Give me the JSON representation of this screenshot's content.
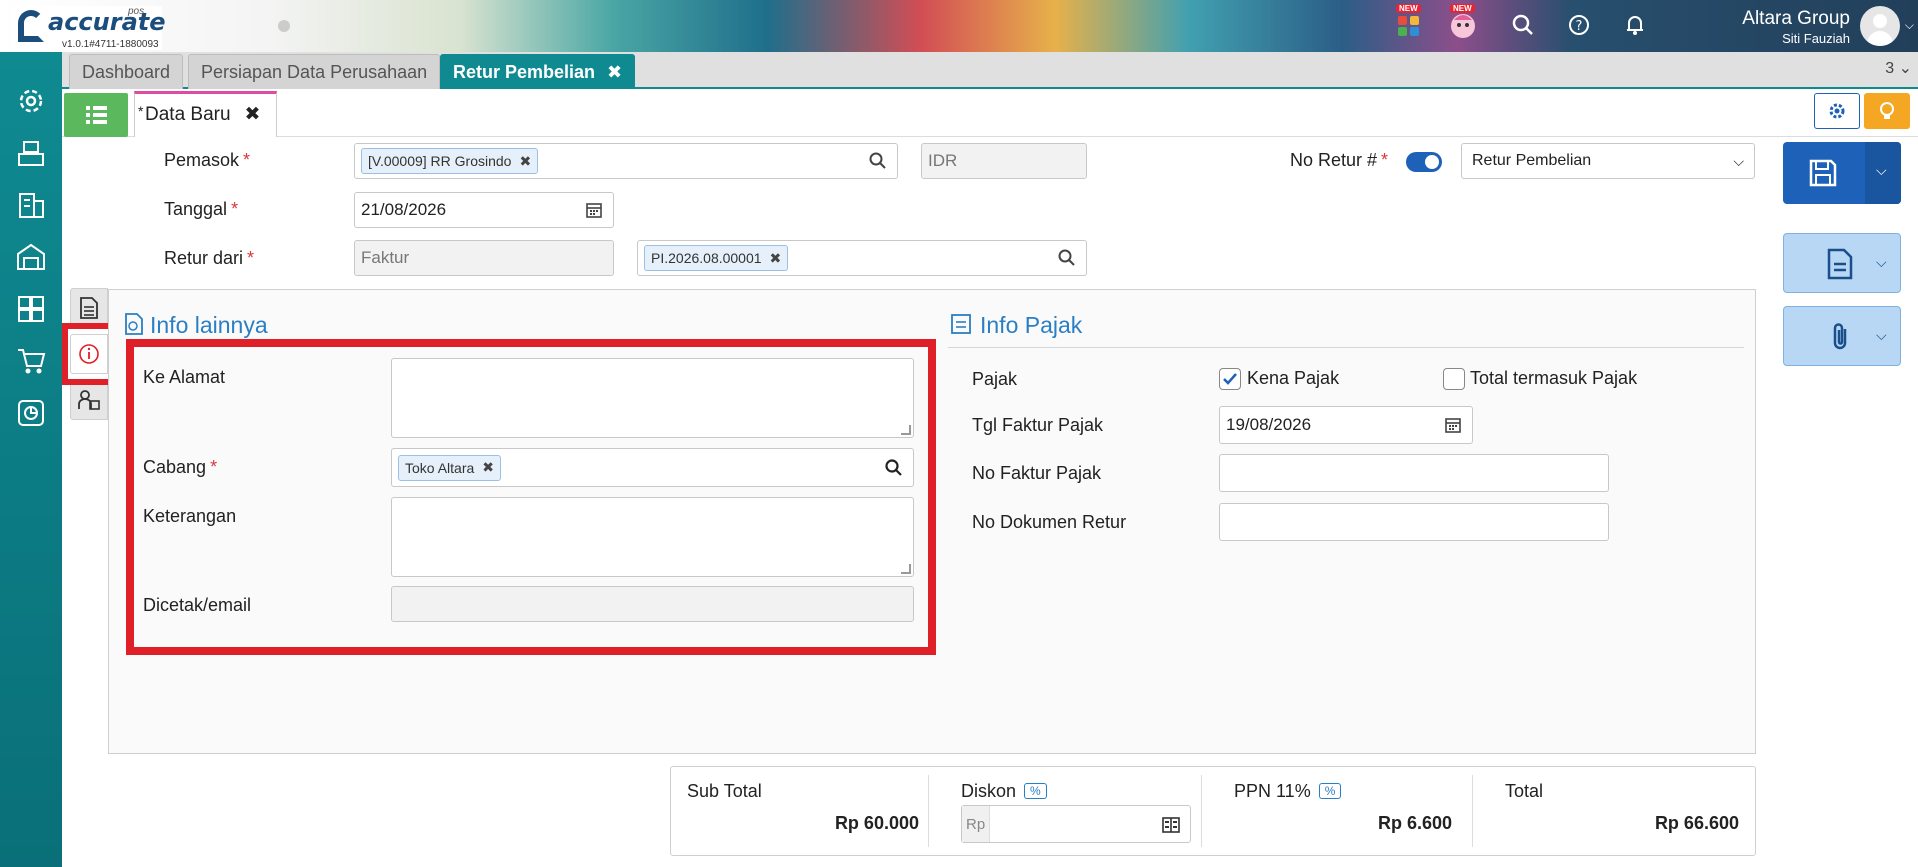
{
  "header": {
    "logo_text": "accurate",
    "logo_pos": "pos",
    "version": "v1.0.1#4711-1880093",
    "badge_new": "NEW",
    "company": "Altara Group",
    "user": "Siti Fauziah"
  },
  "tabs": [
    {
      "label": "Dashboard"
    },
    {
      "label": "Persiapan Data Perusahaan"
    },
    {
      "label": "Retur Pembelian"
    }
  ],
  "tab_count": "3",
  "doc_tab": {
    "star": "*",
    "label": "Data Baru"
  },
  "form": {
    "pemasok_label": "Pemasok",
    "pemasok_value": "[V.00009] RR Grosindo",
    "currency": "IDR",
    "no_retur_label": "No Retur #",
    "no_retur_type": "Retur Pembelian",
    "tanggal_label": "Tanggal",
    "tanggal_value": "21/08/2026",
    "retur_dari_label": "Retur dari",
    "retur_dari_value": "Faktur",
    "faktur_ref": "PI.2026.08.00001"
  },
  "info_lainnya": {
    "title": "Info lainnya",
    "ke_alamat_label": "Ke Alamat",
    "cabang_label": "Cabang",
    "cabang_value": "Toko Altara",
    "keterangan_label": "Keterangan",
    "dicetak_label": "Dicetak/email"
  },
  "info_pajak": {
    "title": "Info Pajak",
    "pajak_label": "Pajak",
    "kena_pajak_label": "Kena Pajak",
    "kena_pajak_checked": true,
    "total_termasuk_label": "Total termasuk Pajak",
    "total_termasuk_checked": false,
    "tgl_faktur_label": "Tgl Faktur Pajak",
    "tgl_faktur_value": "19/08/2026",
    "no_faktur_label": "No Faktur Pajak",
    "no_dokumen_label": "No Dokumen Retur"
  },
  "totals": {
    "sub_total_label": "Sub Total",
    "sub_total_value": "Rp 60.000",
    "diskon_label": "Diskon",
    "pct_symbol": "%",
    "diskon_placeholder": "Rp",
    "ppn_label": "PPN 11%",
    "ppn_value": "Rp 6.600",
    "total_label": "Total",
    "total_value": "Rp 66.600"
  },
  "colors": {
    "accent": "#0f8a91",
    "primary": "#1d62b8",
    "highlight": "#e02028",
    "section_title": "#2a7fc4"
  }
}
